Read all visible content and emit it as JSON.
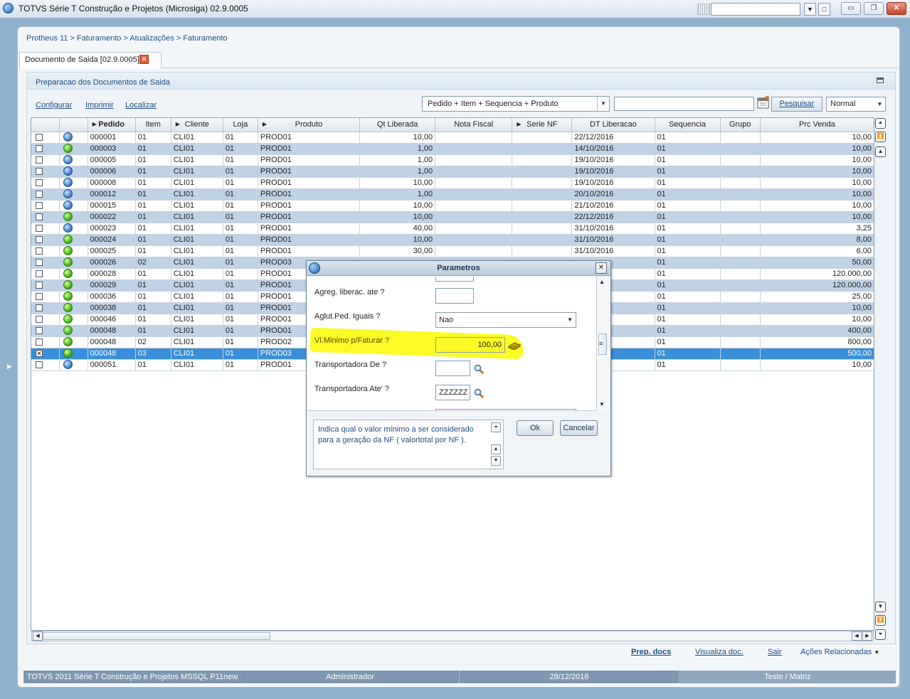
{
  "window": {
    "title": "TOTVS Série T Construção e Projetos (Microsiga) 02.9.0005",
    "combo_value": "",
    "min_label": "▭",
    "restore_label": "❐",
    "close_label": "✕"
  },
  "breadcrumb": "Protheus 11 > Faturamento > Atualizações > Faturamento",
  "tab": {
    "label": "Documento de Saida [02.9.0005]",
    "close": "✕"
  },
  "panel": {
    "title": "Preparacao dos Documentos de Saida"
  },
  "toolbar": {
    "configurar": "Configurar",
    "imprimir": "Imprimir",
    "localizar": "Localizar",
    "search_order": "Pedido + Item + Sequencia + Produto",
    "search_value": "",
    "search_button": "Pesquisar",
    "mode": "Normal"
  },
  "grid": {
    "headers": [
      "",
      "",
      "Pedido",
      "Item",
      "Cliente",
      "Loja",
      "Produto",
      "Qt Liberada",
      "Nota Fiscal",
      "Serie NF",
      "DT Liberacao",
      "Sequencia",
      "Grupo",
      "Prc Venda"
    ],
    "rows": [
      {
        "checked": false,
        "status": "blue",
        "pedido": "000001",
        "item": "01",
        "cliente": "CLI01",
        "loja": "01",
        "produto": "PROD01",
        "qt": "10,00",
        "nf": "",
        "serie": "",
        "dt": "22/12/2016",
        "seq": "01",
        "grupo": "",
        "prc": "10,00"
      },
      {
        "checked": false,
        "status": "green",
        "pedido": "000003",
        "item": "01",
        "cliente": "CLI01",
        "loja": "01",
        "produto": "PROD01",
        "qt": "1,00",
        "nf": "",
        "serie": "",
        "dt": "14/10/2016",
        "seq": "01",
        "grupo": "",
        "prc": "10,00"
      },
      {
        "checked": false,
        "status": "blue",
        "pedido": "000005",
        "item": "01",
        "cliente": "CLI01",
        "loja": "01",
        "produto": "PROD01",
        "qt": "1,00",
        "nf": "",
        "serie": "",
        "dt": "19/10/2016",
        "seq": "01",
        "grupo": "",
        "prc": "10,00"
      },
      {
        "checked": false,
        "status": "blue",
        "pedido": "000006",
        "item": "01",
        "cliente": "CLI01",
        "loja": "01",
        "produto": "PROD01",
        "qt": "1,00",
        "nf": "",
        "serie": "",
        "dt": "19/10/2016",
        "seq": "01",
        "grupo": "",
        "prc": "10,00"
      },
      {
        "checked": false,
        "status": "blue",
        "pedido": "000008",
        "item": "01",
        "cliente": "CLI01",
        "loja": "01",
        "produto": "PROD01",
        "qt": "10,00",
        "nf": "",
        "serie": "",
        "dt": "19/10/2016",
        "seq": "01",
        "grupo": "",
        "prc": "10,00"
      },
      {
        "checked": false,
        "status": "blue",
        "pedido": "000012",
        "item": "01",
        "cliente": "CLI01",
        "loja": "01",
        "produto": "PROD01",
        "qt": "1,00",
        "nf": "",
        "serie": "",
        "dt": "20/10/2016",
        "seq": "01",
        "grupo": "",
        "prc": "10,00"
      },
      {
        "checked": false,
        "status": "blue",
        "pedido": "000015",
        "item": "01",
        "cliente": "CLI01",
        "loja": "01",
        "produto": "PROD01",
        "qt": "10,00",
        "nf": "",
        "serie": "",
        "dt": "21/10/2016",
        "seq": "01",
        "grupo": "",
        "prc": "10,00"
      },
      {
        "checked": false,
        "status": "green",
        "pedido": "000022",
        "item": "01",
        "cliente": "CLI01",
        "loja": "01",
        "produto": "PROD01",
        "qt": "10,00",
        "nf": "",
        "serie": "",
        "dt": "22/12/2016",
        "seq": "01",
        "grupo": "",
        "prc": "10,00"
      },
      {
        "checked": false,
        "status": "blue",
        "pedido": "000023",
        "item": "01",
        "cliente": "CLI01",
        "loja": "01",
        "produto": "PROD01",
        "qt": "40,00",
        "nf": "",
        "serie": "",
        "dt": "31/10/2016",
        "seq": "01",
        "grupo": "",
        "prc": "3,25"
      },
      {
        "checked": false,
        "status": "green",
        "pedido": "000024",
        "item": "01",
        "cliente": "CLI01",
        "loja": "01",
        "produto": "PROD01",
        "qt": "10,00",
        "nf": "",
        "serie": "",
        "dt": "31/10/2016",
        "seq": "01",
        "grupo": "",
        "prc": "8,00"
      },
      {
        "checked": false,
        "status": "green",
        "pedido": "000025",
        "item": "01",
        "cliente": "CLI01",
        "loja": "01",
        "produto": "PROD01",
        "qt": "30,00",
        "nf": "",
        "serie": "",
        "dt": "31/10/2016",
        "seq": "01",
        "grupo": "",
        "prc": "6,00"
      },
      {
        "checked": false,
        "status": "green",
        "pedido": "000026",
        "item": "02",
        "cliente": "CLI01",
        "loja": "01",
        "produto": "PROD03",
        "qt": "",
        "nf": "",
        "serie": "",
        "dt": "",
        "seq": "01",
        "grupo": "",
        "prc": "50,00"
      },
      {
        "checked": false,
        "status": "green",
        "pedido": "000028",
        "item": "01",
        "cliente": "CLI01",
        "loja": "01",
        "produto": "PROD01",
        "qt": "",
        "nf": "",
        "serie": "",
        "dt": "",
        "seq": "01",
        "grupo": "",
        "prc": "120.000,00"
      },
      {
        "checked": false,
        "status": "green",
        "pedido": "000029",
        "item": "01",
        "cliente": "CLI01",
        "loja": "01",
        "produto": "PROD01",
        "qt": "",
        "nf": "",
        "serie": "",
        "dt": "",
        "seq": "01",
        "grupo": "",
        "prc": "120.000,00"
      },
      {
        "checked": false,
        "status": "green",
        "pedido": "000036",
        "item": "01",
        "cliente": "CLI01",
        "loja": "01",
        "produto": "PROD01",
        "qt": "",
        "nf": "",
        "serie": "",
        "dt": "",
        "seq": "01",
        "grupo": "",
        "prc": "25,00"
      },
      {
        "checked": false,
        "status": "green",
        "pedido": "000038",
        "item": "01",
        "cliente": "CLI01",
        "loja": "01",
        "produto": "PROD01",
        "qt": "",
        "nf": "",
        "serie": "",
        "dt": "",
        "seq": "01",
        "grupo": "",
        "prc": "10,00"
      },
      {
        "checked": false,
        "status": "green",
        "pedido": "000046",
        "item": "01",
        "cliente": "CLI01",
        "loja": "01",
        "produto": "PROD01",
        "qt": "",
        "nf": "",
        "serie": "",
        "dt": "",
        "seq": "01",
        "grupo": "",
        "prc": "10,00"
      },
      {
        "checked": false,
        "status": "green",
        "pedido": "000048",
        "item": "01",
        "cliente": "CLI01",
        "loja": "01",
        "produto": "PROD01",
        "qt": "",
        "nf": "",
        "serie": "",
        "dt": "",
        "seq": "01",
        "grupo": "",
        "prc": "400,00"
      },
      {
        "checked": false,
        "status": "green",
        "pedido": "000048",
        "item": "02",
        "cliente": "CLI01",
        "loja": "01",
        "produto": "PROD02",
        "qt": "",
        "nf": "",
        "serie": "",
        "dt": "",
        "seq": "01",
        "grupo": "",
        "prc": "800,00"
      },
      {
        "checked": true,
        "status": "green",
        "pedido": "000048",
        "item": "03",
        "cliente": "CLI01",
        "loja": "01",
        "produto": "PROD03",
        "qt": "",
        "nf": "",
        "serie": "",
        "dt": "",
        "seq": "01",
        "grupo": "",
        "prc": "500,00"
      },
      {
        "checked": false,
        "status": "blue",
        "pedido": "000051",
        "item": "01",
        "cliente": "CLI01",
        "loja": "01",
        "produto": "PROD01",
        "qt": "",
        "nf": "",
        "serie": "",
        "dt": "",
        "seq": "01",
        "grupo": "",
        "prc": "10,00"
      }
    ]
  },
  "footer": {
    "prep_docs": "Prep. docs",
    "visualiza": "Visualiza doc.",
    "sair": "Sair",
    "acoes": "Ações Relacionadas"
  },
  "status": {
    "system": "TOTVS 2011 Série T Construção e Projetos MSSQL P11new",
    "user": "Administrador",
    "date": "28/12/2016",
    "branch": "Teste / Matriz"
  },
  "dialog": {
    "title": "Parametros",
    "close": "✕",
    "params": {
      "agreg_label": "Agreg. liberac. ate ?",
      "agreg_value": "",
      "aglut_label": "Aglut.Ped. Iguais ?",
      "aglut_value": "Nao",
      "vlmin_label": "Vl.Minimo p/Faturar ?",
      "vlmin_value": "100,00",
      "transp_de_label": "Transportadora De ?",
      "transp_de_value": "",
      "transp_ate_label": "Transportadora Ate' ?",
      "transp_ate_value": "ZZZZZZ"
    },
    "help": "Indica qual o valor mínimo a ser considerado para a geração da NF ( valortotal por NF ).",
    "ok": "Ok",
    "cancel": "Cancelar"
  },
  "colors": {
    "accent": "#1f4e84",
    "row_alt": "#bfd2e6",
    "row_selected": "#3a8fd9",
    "highlight": "#fafa00"
  }
}
